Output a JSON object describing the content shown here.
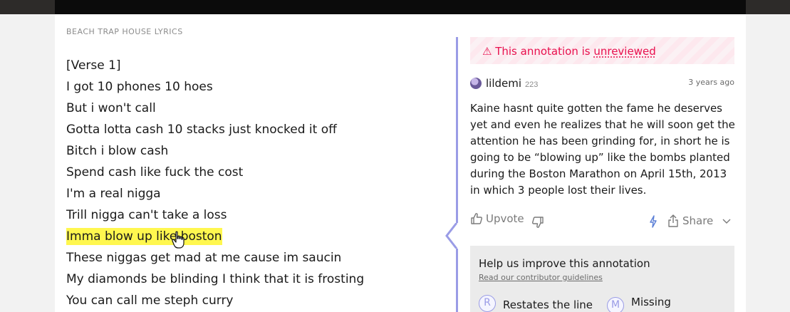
{
  "song": {
    "header_label": "BEACH TRAP HOUSE LYRICS"
  },
  "lyrics": [
    "[Verse 1]",
    "I got 10 phones 10 hoes",
    "But i won't call",
    "Gotta lotta cash 10 stacks just knocked it off",
    "Bitch i blow cash",
    "Spend cash like fuck the cost",
    "I'm a real nigga",
    "Trill nigga can't take a loss",
    "Imma blow up like boston",
    "These niggas get mad at me cause im saucin",
    "My diamonds be blinding I think that it is frosting",
    "You can call me steph curry"
  ],
  "highlighted_index": 8,
  "annotation": {
    "notice_prefix": "⚠ This annotation is ",
    "notice_link": "unreviewed",
    "author_name": "lildemi",
    "author_iq": "223",
    "timestamp": "3 years ago",
    "body": "Kaine hasnt quite gotten the fame he deserves yet and even he realizes that he will soon get the attention he has been grinding for, in short he is going to be “blowing up” like the bombs planted during the Boston Marathon on April 15th, 2013 in which 3 people lost their lives.",
    "upvote_label": "Upvote",
    "share_label": "Share"
  },
  "improve": {
    "title": "Help us improve this annotation",
    "guidelines_link": "Read our contributor guidelines",
    "options": [
      {
        "letter": "R",
        "label": "Restates the line"
      },
      {
        "letter": "M",
        "label": "Missing"
      }
    ]
  },
  "colors": {
    "highlight": "#fff74f",
    "accent": "#9a9ce6",
    "warning": "#e8104e"
  }
}
